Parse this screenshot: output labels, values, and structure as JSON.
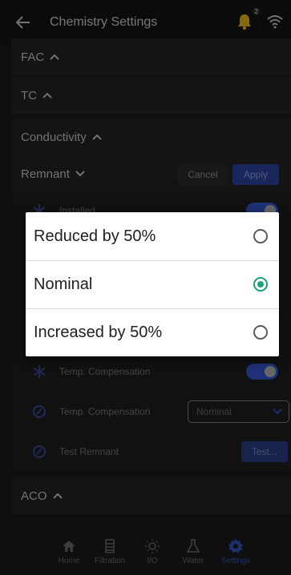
{
  "header": {
    "title": "Chemistry Settings",
    "notification_count": "2"
  },
  "sections": {
    "fac": "FAC",
    "tc": "TC",
    "conductivity": "Conductivity",
    "remnant": "Remnant",
    "aco": "ACO"
  },
  "remnant_actions": {
    "cancel": "Cancel",
    "apply": "Apply"
  },
  "remnant_rows": {
    "installed": "Installed",
    "temp_comp_toggle": "Temp. Compensation",
    "temp_comp_select": "Temp. Compensation",
    "temp_comp_value": "Nominal",
    "test_remnant": "Test Remnant",
    "test_button": "Test..."
  },
  "dialog": {
    "options": [
      {
        "label": "Reduced by 50%",
        "selected": false
      },
      {
        "label": "Nominal",
        "selected": true
      },
      {
        "label": "Increased by 50%",
        "selected": false
      }
    ]
  },
  "nav": {
    "items": [
      {
        "label": "Home",
        "icon": "home-icon"
      },
      {
        "label": "Filtration",
        "icon": "filtration-icon"
      },
      {
        "label": "I/O",
        "icon": "bulb-icon"
      },
      {
        "label": "Water",
        "icon": "flask-icon"
      },
      {
        "label": "Settings",
        "icon": "gear-icon",
        "active": true
      }
    ]
  },
  "colors": {
    "accent": "#3956c8",
    "selected_radio": "#1aa37a",
    "notification": "#f5c21b"
  }
}
